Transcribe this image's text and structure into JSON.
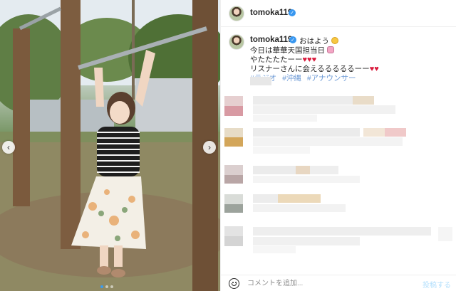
{
  "account": {
    "username": "tomoka119",
    "verified_icon": "verified-badge-icon"
  },
  "caption": {
    "greeting": "おはよう",
    "line1": "今日は華華天国担当日",
    "line2": "やたたたたーー",
    "line3": "リスナーさんに会えるるるるるーー",
    "hashtags": [
      "#ラジオ",
      "#沖縄",
      "#アナウンサー"
    ]
  },
  "carousel": {
    "prev_icon": "chevron-left-icon",
    "next_icon": "chevron-right-icon",
    "prev_glyph": "‹",
    "next_glyph": "›"
  },
  "comment_box": {
    "placeholder": "コメントを追加...",
    "post_label": "投稿する",
    "emoji_icon": "smile-icon"
  },
  "colors": {
    "link": "#6e9bd6",
    "verified": "#3897f0",
    "heart": "#d91a3c",
    "post_disabled": "#b2dffc"
  },
  "more_glyph": "•••",
  "heart_glyph": "♥"
}
